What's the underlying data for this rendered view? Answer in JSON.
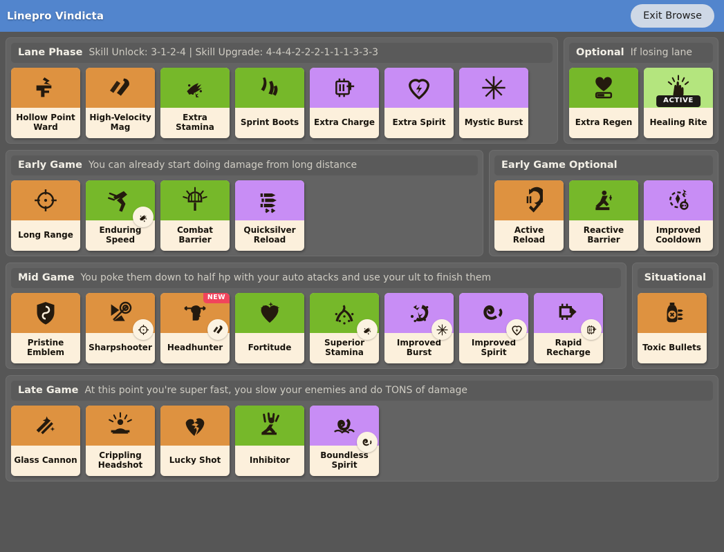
{
  "titlebar": {
    "build_name": "Linepro Vindicta",
    "exit_label": "Exit Browse"
  },
  "colors": {
    "accent_blue": "#5285cd",
    "page_bg": "#565656",
    "panel_bg": "#636363",
    "header_bg": "#5a5a5a",
    "weapon_orange": "#de9240",
    "vitality_green": "#76b82a",
    "spirit_purple": "#c88df5",
    "active_lightgreen": "#b4e57e",
    "card_cream": "#fcf0dc",
    "new_ribbon_red": "#f1445c"
  },
  "sections": [
    {
      "id": "lane-phase",
      "title": "Lane Phase",
      "subtitle": "Skill Unlock: 3-1-2-4 | Skill Upgrade: 4-4-4-2-2-2-1-1-1-3-3-3",
      "width": "grow",
      "items": [
        {
          "name": "Hollow Point Ward",
          "category": "weapon",
          "icon": "hollow-point-ward-icon"
        },
        {
          "name": "High-Velocity Mag",
          "category": "weapon",
          "icon": "high-velocity-mag-icon"
        },
        {
          "name": "Extra Stamina",
          "category": "vitality",
          "icon": "extra-stamina-icon"
        },
        {
          "name": "Sprint Boots",
          "category": "vitality",
          "icon": "sprint-boots-icon"
        },
        {
          "name": "Extra Charge",
          "category": "spirit",
          "icon": "extra-charge-icon"
        },
        {
          "name": "Extra Spirit",
          "category": "spirit",
          "icon": "extra-spirit-icon"
        },
        {
          "name": "Mystic Burst",
          "category": "spirit",
          "icon": "mystic-burst-icon"
        }
      ]
    },
    {
      "id": "optional",
      "title": "Optional",
      "subtitle": "If losing lane",
      "width": "shrink",
      "items": [
        {
          "name": "Extra Regen",
          "category": "vitality",
          "icon": "extra-regen-icon"
        },
        {
          "name": "Healing Rite",
          "category": "vitality-active",
          "icon": "healing-rite-icon",
          "badge": "ACTIVE"
        }
      ]
    },
    {
      "id": "early-game",
      "title": "Early Game",
      "subtitle": "You can already start doing damage from long distance",
      "width": "grow",
      "items": [
        {
          "name": "Long Range",
          "category": "weapon",
          "icon": "long-range-icon"
        },
        {
          "name": "Enduring Speed",
          "category": "vitality",
          "icon": "enduring-speed-icon",
          "requires": "extra-stamina-icon"
        },
        {
          "name": "Combat Barrier",
          "category": "vitality",
          "icon": "combat-barrier-icon"
        },
        {
          "name": "Quicksilver Reload",
          "category": "spirit",
          "icon": "quicksilver-reload-icon"
        }
      ]
    },
    {
      "id": "early-game-optional",
      "title": "Early Game Optional",
      "subtitle": "",
      "width": "shrink",
      "items": [
        {
          "name": "Active Reload",
          "category": "weapon",
          "icon": "active-reload-icon"
        },
        {
          "name": "Reactive Barrier",
          "category": "vitality",
          "icon": "reactive-barrier-icon"
        },
        {
          "name": "Improved Cooldown",
          "category": "spirit",
          "icon": "improved-cooldown-icon"
        }
      ]
    },
    {
      "id": "mid-game",
      "title": "Mid Game",
      "subtitle": "You poke them down to half hp with your auto atacks and use your ult to finish them",
      "width": "grow",
      "items": [
        {
          "name": "Pristine Emblem",
          "category": "weapon",
          "icon": "pristine-emblem-icon"
        },
        {
          "name": "Sharpshooter",
          "category": "weapon",
          "icon": "sharpshooter-icon",
          "requires": "long-range-icon"
        },
        {
          "name": "Headhunter",
          "category": "weapon",
          "icon": "headhunter-icon",
          "requires": "high-velocity-mag-icon",
          "badge": "NEW"
        },
        {
          "name": "Fortitude",
          "category": "vitality",
          "icon": "fortitude-icon"
        },
        {
          "name": "Superior Stamina",
          "category": "vitality",
          "icon": "superior-stamina-icon",
          "requires": "extra-stamina-icon"
        },
        {
          "name": "Improved Burst",
          "category": "spirit",
          "icon": "improved-burst-icon",
          "requires": "mystic-burst-icon"
        },
        {
          "name": "Improved Spirit",
          "category": "spirit",
          "icon": "improved-spirit-icon",
          "requires": "extra-spirit-icon"
        },
        {
          "name": "Rapid Recharge",
          "category": "spirit",
          "icon": "rapid-recharge-icon",
          "requires": "extra-charge-icon"
        }
      ]
    },
    {
      "id": "situational",
      "title": "Situational",
      "subtitle": "",
      "width": "shrink",
      "items": [
        {
          "name": "Toxic Bullets",
          "category": "weapon",
          "icon": "toxic-bullets-icon"
        }
      ]
    },
    {
      "id": "late-game",
      "title": "Late Game",
      "subtitle": "At this point you're super fast, you slow your enemies and do TONS of damage",
      "width": "grow",
      "items": [
        {
          "name": "Glass Cannon",
          "category": "weapon",
          "icon": "glass-cannon-icon"
        },
        {
          "name": "Crippling Headshot",
          "category": "weapon",
          "icon": "crippling-headshot-icon"
        },
        {
          "name": "Lucky Shot",
          "category": "weapon",
          "icon": "lucky-shot-icon"
        },
        {
          "name": "Inhibitor",
          "category": "vitality",
          "icon": "inhibitor-icon"
        },
        {
          "name": "Boundless Spirit",
          "category": "spirit",
          "icon": "boundless-spirit-icon",
          "requires": "improved-spirit-icon"
        }
      ]
    }
  ],
  "layout_rows": [
    [
      "lane-phase",
      "optional"
    ],
    [
      "early-game",
      "early-game-optional"
    ],
    [
      "mid-game",
      "situational"
    ],
    [
      "late-game"
    ]
  ]
}
